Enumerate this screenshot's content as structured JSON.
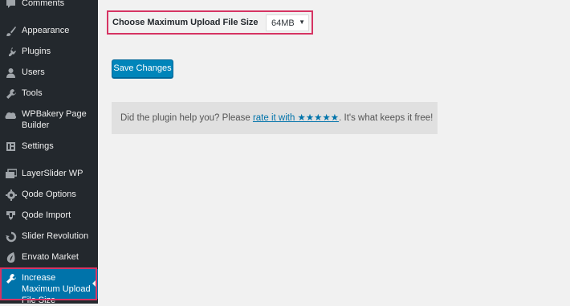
{
  "sidebar": {
    "items": [
      {
        "label": "Comments",
        "icon": "comments-icon"
      },
      {
        "label": "Appearance",
        "icon": "appearance-icon"
      },
      {
        "label": "Plugins",
        "icon": "plugins-icon"
      },
      {
        "label": "Users",
        "icon": "users-icon"
      },
      {
        "label": "Tools",
        "icon": "tools-icon"
      },
      {
        "label": "WPBakery Page Builder",
        "icon": "wpbakery-icon"
      },
      {
        "label": "Settings",
        "icon": "settings-icon"
      },
      {
        "label": "LayerSlider WP",
        "icon": "layerslider-icon"
      },
      {
        "label": "Qode Options",
        "icon": "qode-options-icon"
      },
      {
        "label": "Qode Import",
        "icon": "qode-import-icon"
      },
      {
        "label": "Slider Revolution",
        "icon": "slider-revolution-icon"
      },
      {
        "label": "Envato Market",
        "icon": "envato-icon"
      },
      {
        "label": "Increase Maximum Upload File Size",
        "icon": "wrench-icon"
      }
    ]
  },
  "main": {
    "setting_label": "Choose Maximum Upload File Size",
    "select_value": "64MB",
    "save_label": "Save Changes",
    "rate_prefix": "Did the plugin help you? Please ",
    "rate_link": "rate it with ★★★★★",
    "rate_suffix": ". It's what keeps it free!"
  },
  "colors": {
    "sidebar_bg": "#23282d",
    "active_bg": "#0073aa",
    "highlight": "#d63463",
    "button_bg": "#0085ba"
  }
}
